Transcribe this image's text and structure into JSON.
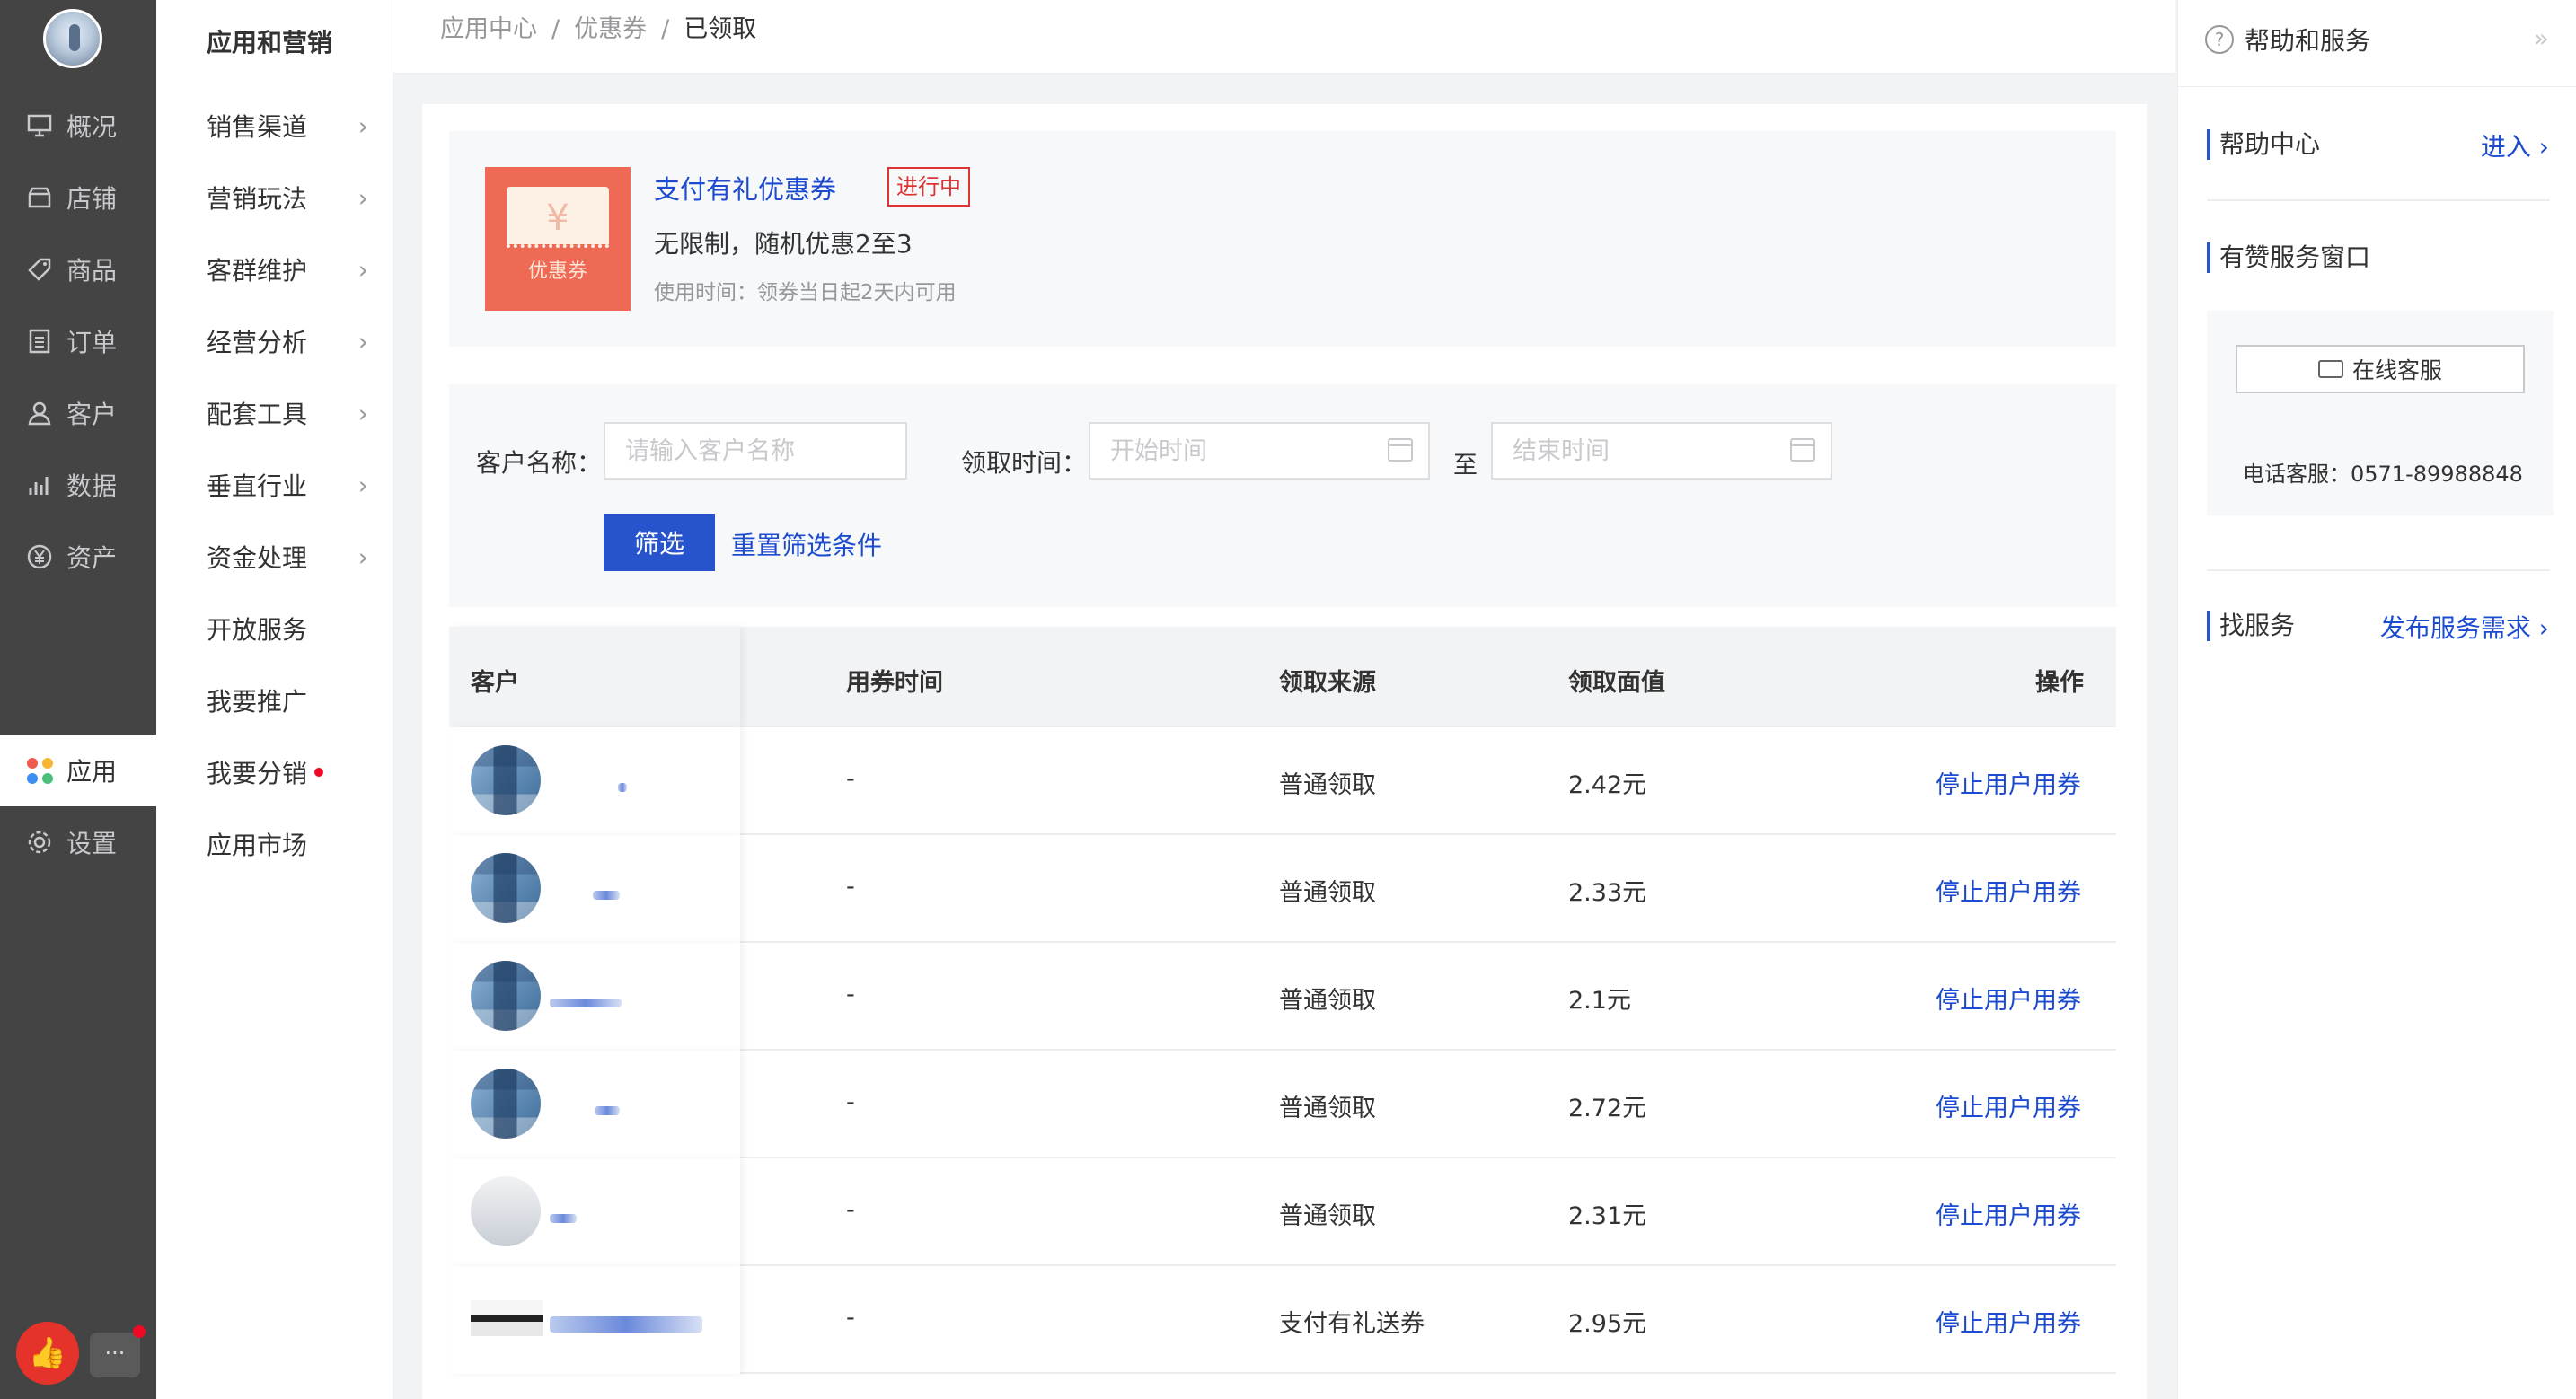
{
  "nav_primary": {
    "items": [
      {
        "label": "概况",
        "icon": "monitor-icon"
      },
      {
        "label": "店铺",
        "icon": "store-icon"
      },
      {
        "label": "商品",
        "icon": "tag-icon"
      },
      {
        "label": "订单",
        "icon": "list-icon"
      },
      {
        "label": "客户",
        "icon": "user-icon"
      },
      {
        "label": "数据",
        "icon": "bar-chart-icon"
      },
      {
        "label": "资产",
        "icon": "yen-icon"
      },
      {
        "label": "应用",
        "icon": "apps-icon"
      },
      {
        "label": "设置",
        "icon": "gear-icon"
      }
    ]
  },
  "nav_secondary": {
    "title": "应用和营销",
    "items": [
      {
        "label": "销售渠道"
      },
      {
        "label": "营销玩法"
      },
      {
        "label": "客群维护"
      },
      {
        "label": "经营分析"
      },
      {
        "label": "配套工具"
      },
      {
        "label": "垂直行业"
      },
      {
        "label": "资金处理"
      },
      {
        "label": "开放服务"
      },
      {
        "label": "我要推广"
      },
      {
        "label": "我要分销"
      },
      {
        "label": "应用市场"
      }
    ]
  },
  "breadcrumb": [
    "应用中心",
    "优惠券",
    "已领取"
  ],
  "coupon": {
    "image_label": "优惠券",
    "image_symbol": "¥",
    "name": "支付有礼优惠券",
    "status": "进行中",
    "desc": "无限制，随机优惠2至3",
    "time": "使用时间：领券当日起2天内可用"
  },
  "filter": {
    "customer_label": "客户名称：",
    "customer_placeholder": "请输入客户名称",
    "time_label": "领取时间：",
    "start_placeholder": "开始时间",
    "to": "至",
    "end_placeholder": "结束时间",
    "submit": "筛选",
    "reset": "重置筛选条件"
  },
  "table": {
    "columns": [
      "客户",
      "用券时间",
      "领取来源",
      "领取面值",
      "操作"
    ],
    "rows": [
      {
        "use_time": "-",
        "source": "普通领取",
        "value": "2.42元",
        "action": "停止用户用券"
      },
      {
        "use_time": "-",
        "source": "普通领取",
        "value": "2.33元",
        "action": "停止用户用券"
      },
      {
        "use_time": "-",
        "source": "普通领取",
        "value": "2.1元",
        "action": "停止用户用券"
      },
      {
        "use_time": "-",
        "source": "普通领取",
        "value": "2.72元",
        "action": "停止用户用券"
      },
      {
        "use_time": "-",
        "source": "普通领取",
        "value": "2.31元",
        "action": "停止用户用券"
      },
      {
        "use_time": "-",
        "source": "支付有礼送券",
        "value": "2.95元",
        "action": "停止用户用券"
      }
    ]
  },
  "right_panel": {
    "title": "帮助和服务",
    "help_center": "帮助中心",
    "help_enter": "进入",
    "service_window": "有赞服务窗口",
    "online_service": "在线客服",
    "phone": "电话客服：0571-89988848",
    "find_service": "找服务",
    "publish_service": "发布服务需求"
  },
  "colors": {
    "accent": "#2754cc",
    "link": "#1c4bd0",
    "nav_dark": "#444444",
    "danger": "#dd3333"
  }
}
